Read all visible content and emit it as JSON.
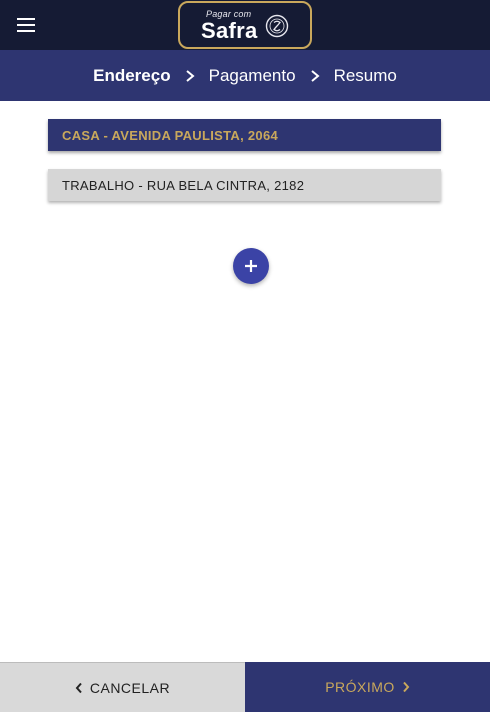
{
  "header": {
    "menu_icon": "hamburger-menu-icon",
    "logo": {
      "small_text": "Pagar com",
      "brand": "Safra",
      "seal_icon": "safra-seal-icon"
    }
  },
  "steps": [
    {
      "label": "Endereço",
      "active": true
    },
    {
      "label": "Pagamento",
      "active": false
    },
    {
      "label": "Resumo",
      "active": false
    }
  ],
  "addresses": [
    {
      "label": "CASA - AVENIDA PAULISTA, 2064",
      "selected": true
    },
    {
      "label": "TRABALHO - RUA BELA CINTRA, 2182",
      "selected": false
    }
  ],
  "add_button_icon": "plus-icon",
  "footer": {
    "cancel_label": "CANCELAR",
    "next_label": "PRÓXIMO"
  },
  "colors": {
    "topbar": "#151b34",
    "primary": "#2e3571",
    "gold": "#c9a85c",
    "fab": "#3b43a6",
    "light_gray": "#d6d6d6"
  }
}
